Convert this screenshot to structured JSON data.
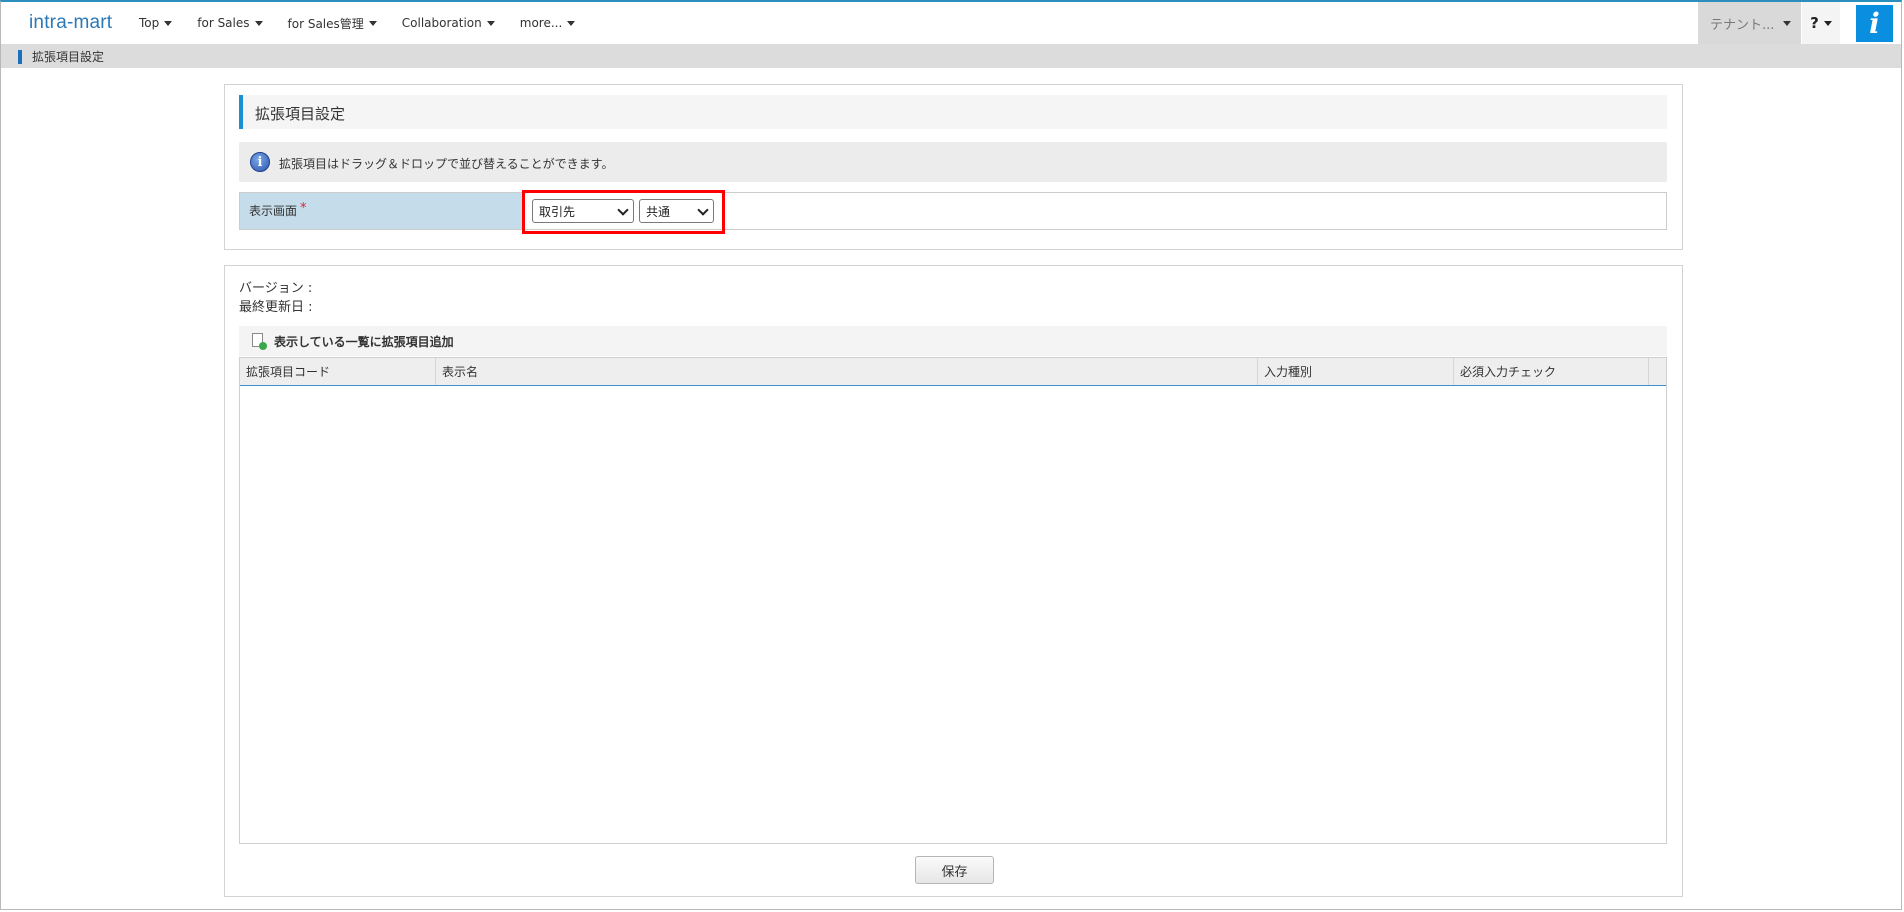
{
  "header": {
    "logo": "intra-mart",
    "nav": [
      {
        "label": "Top"
      },
      {
        "label": "for Sales"
      },
      {
        "label": "for Sales管理"
      },
      {
        "label": "Collaboration"
      },
      {
        "label": "more..."
      }
    ],
    "tenant_label": "テナント...",
    "help_label": "?",
    "brand_glyph": "i"
  },
  "breadcrumb": {
    "current": "拡張項目設定"
  },
  "settings_panel": {
    "title": "拡張項目設定",
    "info_message": "拡張項目はドラッグ＆ドロップで並び替えることができます。",
    "form": {
      "label": "表示画面",
      "required_mark": "*",
      "screen_select_value": "取引先",
      "scope_select_value": "共通"
    }
  },
  "items_panel": {
    "version_label": "バージョン :",
    "last_updated_label": "最終更新日 :",
    "add_button_label": "表示している一覧に拡張項目追加",
    "columns": [
      {
        "label": "拡張項目コード"
      },
      {
        "label": "表示名"
      },
      {
        "label": "入力種別"
      },
      {
        "label": "必須入力チェック"
      }
    ],
    "rows": [],
    "save_label": "保存"
  },
  "colors": {
    "accent": "#1a8fd1",
    "highlight_border": "#ff0000",
    "form_label_bg": "#c5dcea",
    "brand_icon_bg": "#0a8fe0"
  }
}
